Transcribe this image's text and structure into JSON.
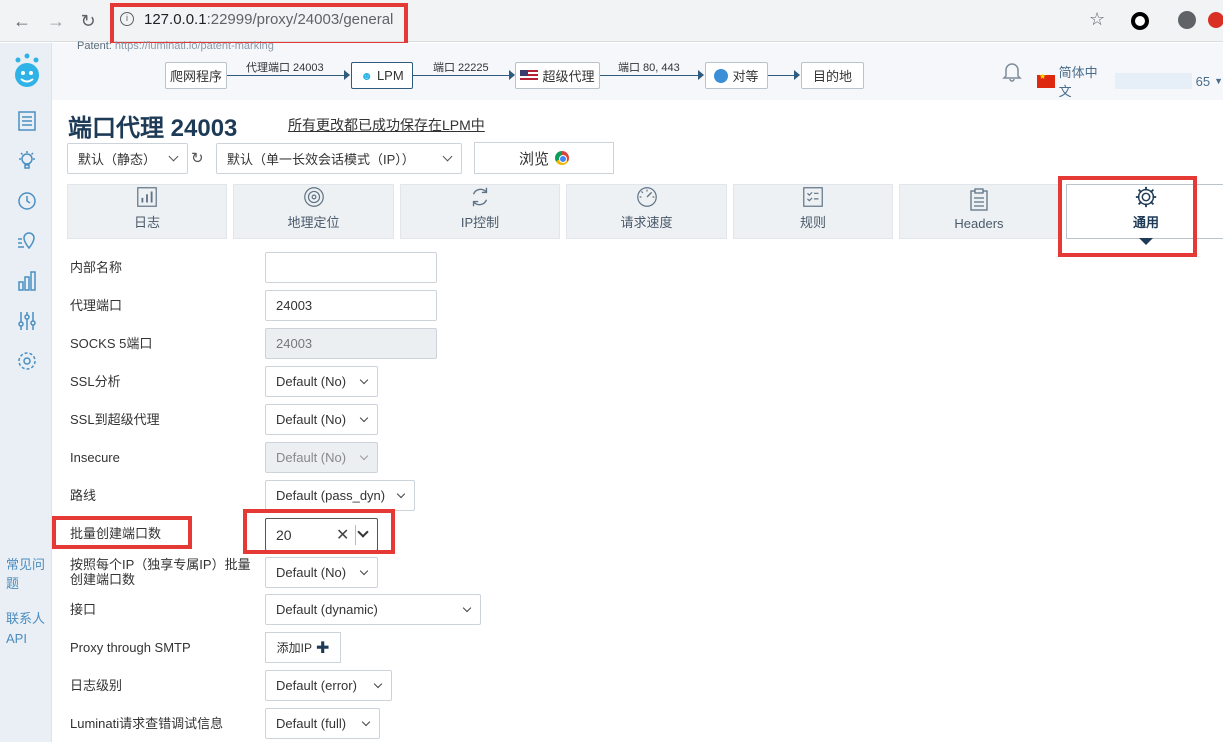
{
  "browser": {
    "url_host": "127.0.0.1",
    "url_path": ":22999/proxy/24003/general"
  },
  "header": {
    "patent_label": "Patent: ",
    "patent_link": "https://luminati.io/patent-marking",
    "flow": {
      "crawler": "爬网程序",
      "proxy_port_label": "代理端口 24003",
      "lpm": "LPM",
      "port_label_1": "端口 22225",
      "super_proxy": "超级代理",
      "port_label_2": "端口 80, 443",
      "peer": "对等",
      "destination": "目的地"
    },
    "language": "简体中文",
    "language_suffix": "65"
  },
  "sidebar": {
    "links": [
      "常见问题",
      "联系人",
      "API"
    ]
  },
  "page": {
    "title": "端口代理 24003",
    "saved_message": "所有更改都已成功保存在LPM中",
    "preset_select": "默认（静态）",
    "session_select": "默认（单一长效会话模式（IP））",
    "browse_button": "浏览"
  },
  "tabs": [
    {
      "label": "日志",
      "icon": "bar-chart-icon"
    },
    {
      "label": "地理定位",
      "icon": "fingerprint-icon"
    },
    {
      "label": "IP控制",
      "icon": "refresh-icon"
    },
    {
      "label": "请求速度",
      "icon": "speedometer-icon"
    },
    {
      "label": "规则",
      "icon": "checklist-icon"
    },
    {
      "label": "Headers",
      "icon": "clipboard-icon"
    },
    {
      "label": "通用",
      "icon": "gear-icon"
    }
  ],
  "form": {
    "internal_name": {
      "label": "内部名称",
      "value": ""
    },
    "proxy_port": {
      "label": "代理端口",
      "value": "24003"
    },
    "socks_port": {
      "label": "SOCKS 5端口",
      "value": "24003"
    },
    "ssl_analysis": {
      "label": "SSL分析",
      "value": "Default (No)"
    },
    "ssl_super": {
      "label": "SSL到超级代理",
      "value": "Default (No)"
    },
    "insecure": {
      "label": "Insecure",
      "value": "Default (No)"
    },
    "route": {
      "label": "路线",
      "value": "Default (pass_dyn)"
    },
    "multiply": {
      "label": "批量创建端口数",
      "value": "20"
    },
    "multiply_ip": {
      "label": "按照每个IP（独享专属IP）批量创建端口数",
      "value": "Default (No)"
    },
    "interface": {
      "label": "接口",
      "value": "Default (dynamic)"
    },
    "smtp": {
      "label": "Proxy through SMTP",
      "button": "添加IP"
    },
    "log_level": {
      "label": "日志级别",
      "value": "Default (error)"
    },
    "debug_info": {
      "label": "Luminati请求查错调试信息",
      "value": "Default (full)"
    }
  }
}
